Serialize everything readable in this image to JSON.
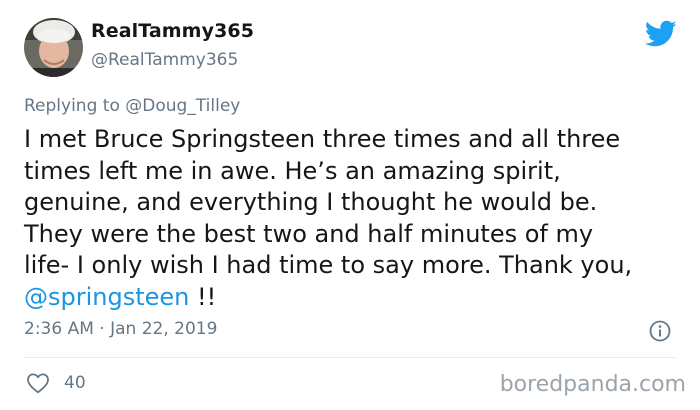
{
  "user": {
    "display_name": "RealTammy365",
    "handle": "@RealTammy365"
  },
  "reply": {
    "prefix": "Replying to",
    "to": "@Doug_Tilley"
  },
  "tweet": {
    "lines": [
      "I met Bruce Springsteen three times and all three",
      "times left me in awe. He’s an amazing spirit,",
      "genuine, and everything I thought he would be.",
      "They were the best two and half minutes of my",
      "life- I only wish I had time to say more. Thank you,"
    ],
    "mention": "@springsteen",
    "suffix": " !!"
  },
  "meta": {
    "timestamp": "2:36 AM · Jan 22, 2019"
  },
  "likes": {
    "count": "40"
  },
  "watermark": "boredpanda.com",
  "icons": {
    "brand": "twitter-bird-icon",
    "info": "info-icon",
    "like": "heart-icon"
  },
  "colors": {
    "accent": "#1da1f2",
    "link": "#1b95e0",
    "muted": "#657786",
    "text": "#14171a",
    "divider": "#e6ecf0"
  }
}
